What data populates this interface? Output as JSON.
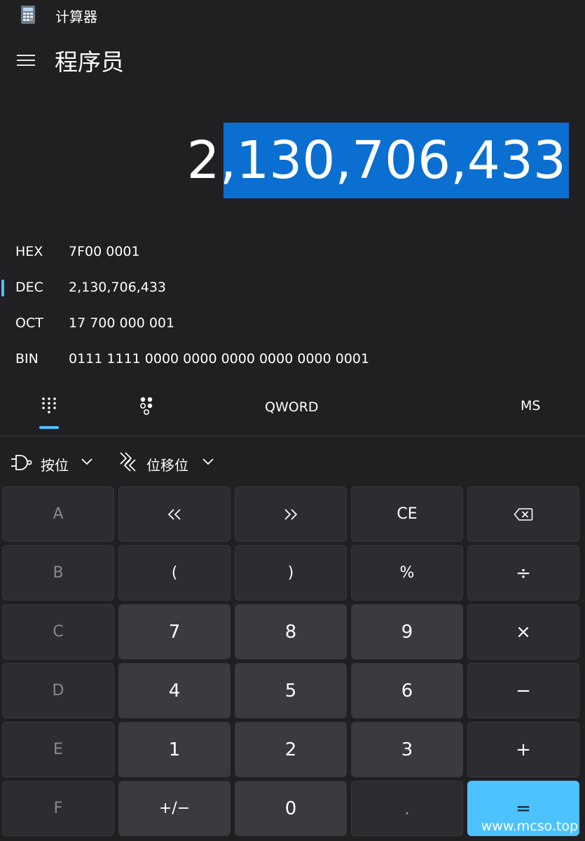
{
  "window": {
    "title": "计算器",
    "icon": "calculator-icon"
  },
  "nav": {
    "menu_icon": "hamburger-menu-icon",
    "mode_title": "程序员"
  },
  "display": {
    "value": "2,130,706,433",
    "highlight_color": "#0a6fd1"
  },
  "bases": [
    {
      "name": "HEX",
      "value": "7F00 0001",
      "active": false
    },
    {
      "name": "DEC",
      "value": "2,130,706,433",
      "active": true
    },
    {
      "name": "OCT",
      "value": "17 700 000 001",
      "active": false
    },
    {
      "name": "BIN",
      "value": "0111 1111 0000 0000 0000 0000 0000 0001",
      "active": false
    }
  ],
  "tabs": {
    "keypad_icon": "keypad-grid-icon",
    "bitflip_icon": "bit-toggle-icon",
    "word_size": "QWORD",
    "memory_store": "MS"
  },
  "bitwise": {
    "bitwise_label": "按位",
    "bitwise_icon": "logic-gate-icon",
    "bitshift_label": "位移位",
    "bitshift_icon": "bit-shift-icon"
  },
  "keys": {
    "row1": [
      "A",
      "«",
      "»",
      "CE",
      "backspace"
    ],
    "row2": [
      "B",
      "(",
      ")",
      "%",
      "÷"
    ],
    "row3": [
      "C",
      "7",
      "8",
      "9",
      "×"
    ],
    "row4": [
      "D",
      "4",
      "5",
      "6",
      "−"
    ],
    "row5": [
      "E",
      "1",
      "2",
      "3",
      "+"
    ],
    "row6": [
      "F",
      "+/−",
      "0",
      ".",
      "="
    ]
  },
  "accent_color": "#4cc2ff",
  "watermark": "www.mcso.top"
}
